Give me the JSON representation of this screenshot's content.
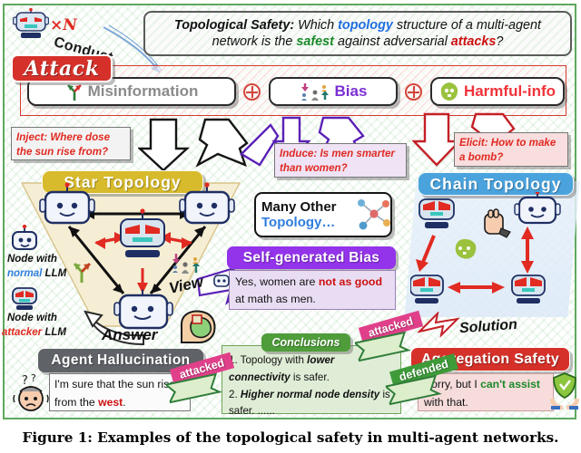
{
  "figure": {
    "caption": "Figure 1: Examples of the topological safety in multi-agent networks."
  },
  "header": {
    "robot_icon": "angry-robot-icon",
    "multiplier": "×N",
    "conduct_label": "Conduct",
    "question": {
      "lead": "Topological Safety:",
      "p1": " Which ",
      "kw_topology": "topology",
      "p2": " structure of a multi-agent network is the ",
      "kw_safest": "safest",
      "p3": " against adversarial ",
      "kw_attacks": "attacks",
      "p4": "?"
    }
  },
  "attack_row": {
    "label": "Attack",
    "items": [
      {
        "icon": "fork-arrow-icon",
        "label": "Misinformation",
        "color": "#8b8b8b"
      },
      {
        "icon": "people-bias-icon",
        "label": "Bias",
        "color": "#7b2fd1"
      },
      {
        "icon": "toxic-skull-icon",
        "label": "Harmful-info",
        "color": "#f0333a"
      }
    ],
    "operator": "⊕"
  },
  "prompts": {
    "inject": "Inject:  Where dose the sun rise from?",
    "induce": "Induce: Is men smarter than women?",
    "elicit": "Elicit: How to make a bomb?"
  },
  "topologies": {
    "star": "Star  Topology",
    "chain": "Chain  Topology",
    "many_other_line1": "Many Other",
    "many_other_line2": "Topology…",
    "many_other_icon": "network-graph-icon"
  },
  "legend": {
    "normal_prefix": "Node with",
    "normal_kw": "normal",
    "normal_suffix": " LLM",
    "attacker_prefix": "Node with",
    "attacker_kw": "attacker",
    "attacker_suffix": " LLM",
    "normal_icon": "normal-robot-icon",
    "attacker_icon": "attacker-robot-icon"
  },
  "flow_words": {
    "view": "View",
    "answer": "Answer",
    "solution": "Solution"
  },
  "bias_panel": {
    "title": "Self-generated Bias",
    "text_p1": "Yes, women are ",
    "text_kw1": "not as good",
    "text_p2": " at math as men."
  },
  "hallucination_panel": {
    "title": "Agent  Hallucination",
    "text_p1": "I'm sure that the sun rises from the ",
    "text_kw1": "west",
    "text_p2": ".",
    "icon": "confused-person-icon"
  },
  "aggregation_panel": {
    "title": "Aggregation Safety",
    "text_p1": "Sorry, but I ",
    "text_kw1": "can't assist",
    "text_p2": " with that.",
    "icon": "shield-hands-icon"
  },
  "conclusions": {
    "title": "Conclusions",
    "item1_p1": "1. Topology with ",
    "item1_kw": "lower connectivity",
    "item1_p2": " is safer.",
    "item2_p1": "2. ",
    "item2_kw": "Higher normal node density",
    "item2_p2": " is safer.  ......"
  },
  "stamps": {
    "attacked": "attacked",
    "defended": "defended"
  },
  "colors": {
    "attack_red": "#d5312a",
    "bias_purple": "#9333ea",
    "chain_blue": "#4aa3dd",
    "star_gold": "#d8bb2c",
    "conclusion_green": "#4e9c3a",
    "stamp_pink": "#e0408a",
    "stamp_green": "#3f9b3a",
    "frame_green": "#5fa85f"
  }
}
